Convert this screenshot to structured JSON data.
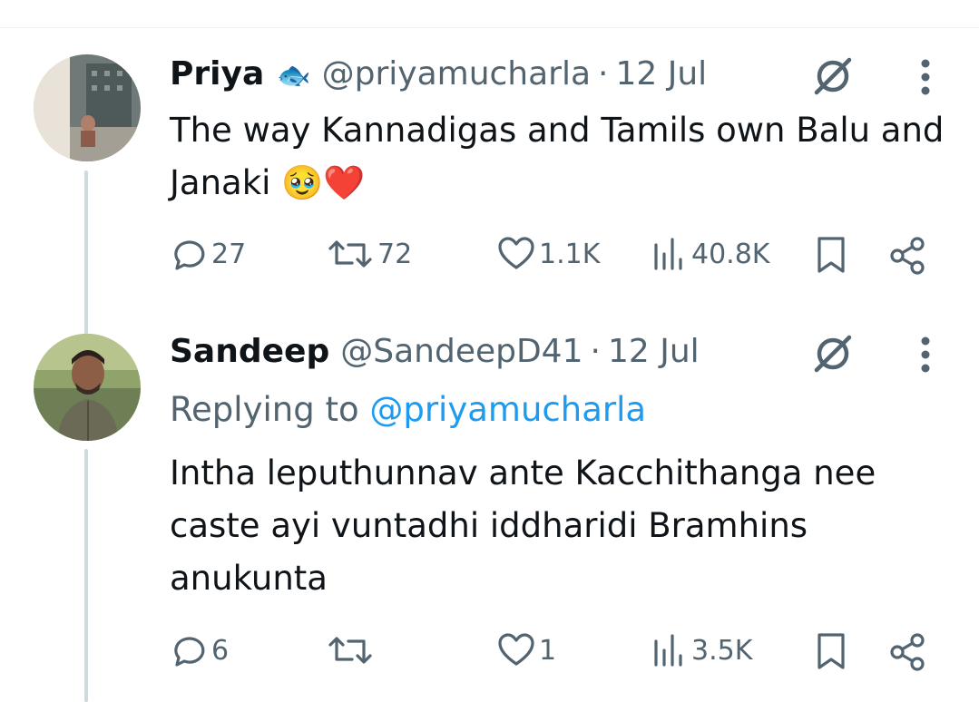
{
  "tweet1": {
    "name": "Priya",
    "name_emoji": "🐟",
    "handle": "@priyamucharla",
    "separator": "·",
    "date": "12 Jul",
    "text": "The way Kannadigas and Tamils own Balu and Janaki 🥹❤️",
    "actions": {
      "replies": "27",
      "reposts": "72",
      "likes": "1.1K",
      "views": "40.8K"
    }
  },
  "tweet2": {
    "name": "Sandeep",
    "handle": "@SandeepD41",
    "separator": "·",
    "date": "12 Jul",
    "replying_label": "Replying to ",
    "replying_handle": "@priyamucharla",
    "text": "Intha leputhunnav ante Kacchithanga nee caste ayi vuntadhi iddharidi Bramhins anukunta",
    "actions": {
      "replies": "6",
      "reposts": "",
      "likes": "1",
      "views": "3.5K"
    }
  },
  "colors": {
    "text": "#0f1419",
    "secondary": "#536471",
    "link": "#1d9bf0",
    "thread_line": "#cfd9de"
  }
}
